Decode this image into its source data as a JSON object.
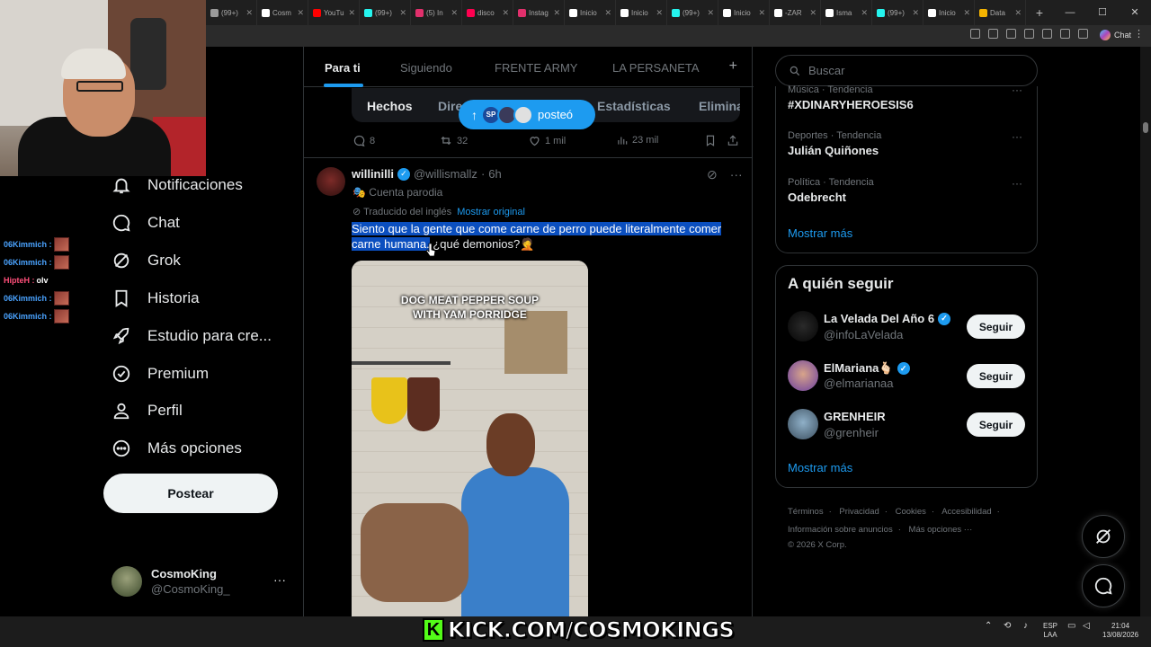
{
  "browser": {
    "tabs": [
      {
        "label": "(99+)",
        "color": "#9a9a9a"
      },
      {
        "label": "Cosm",
        "color": "#ffffff"
      },
      {
        "label": "YouTu",
        "color": "#ff0000"
      },
      {
        "label": "(99+)",
        "color": "#25f4ee"
      },
      {
        "label": "(5) In",
        "color": "#e1306c"
      },
      {
        "label": "disco",
        "color": "#ff0050"
      },
      {
        "label": "Instag",
        "color": "#e1306c"
      },
      {
        "label": "Inicio",
        "color": "#ffffff"
      },
      {
        "label": "Inicio",
        "color": "#ffffff"
      },
      {
        "label": "(99+)",
        "color": "#25f4ee"
      },
      {
        "label": "Inicio",
        "color": "#ffffff"
      },
      {
        "label": "-ZAR",
        "color": "#ffffff"
      },
      {
        "label": "Isma",
        "color": "#ffffff"
      },
      {
        "label": "(99+)",
        "color": "#25f4ee"
      },
      {
        "label": "Inicio",
        "color": "#ffffff"
      },
      {
        "label": "Data",
        "color": "#f4b400"
      }
    ],
    "chat_label": "Chat"
  },
  "chat_overlay": [
    {
      "user": "06Kimmich :",
      "msg": "",
      "emote": true,
      "red": false
    },
    {
      "user": "06Kimmich :",
      "msg": "",
      "emote": true,
      "red": false
    },
    {
      "user": "HipteH :",
      "msg": "olv",
      "emote": false,
      "red": true
    },
    {
      "user": "06Kimmich :",
      "msg": "",
      "emote": true,
      "red": false
    },
    {
      "user": "06Kimmich :",
      "msg": "",
      "emote": true,
      "red": false
    }
  ],
  "nav": {
    "notifications": "Notificaciones",
    "chat": "Chat",
    "grok": "Grok",
    "history": "Historia",
    "studio": "Estudio para cre...",
    "premium": "Premium",
    "profile": "Perfil",
    "more": "Más opciones",
    "post_button": "Postear"
  },
  "account": {
    "name": "CosmoKing",
    "handle": "@CosmoKing_"
  },
  "feed": {
    "tabs": [
      "Para ti",
      "Siguiendo",
      "FRENTE ARMY",
      "LA PERSANETA"
    ],
    "chips": [
      "Hechos",
      "Dire",
      "Estadísticas",
      "Elimina"
    ],
    "new_posts_label": "posteó",
    "new_posts_avatar": "SP",
    "prev_post_stats": {
      "replies": "8",
      "reposts": "32",
      "likes": "1 mil",
      "views": "23 mil"
    }
  },
  "post": {
    "name": "willinilli",
    "handle": "@willismallz",
    "time": "6h",
    "badge": "Cuenta parodia",
    "translated_label": "Traducido del inglés",
    "show_original": "Mostrar original",
    "text_selected": "Siento que la gente que come carne de perro puede literalmente comer carne humana.",
    "text_rest": " ¿qué demonios?🤦",
    "media_caption_1": "DOG MEAT PEPPER SOUP",
    "media_caption_2": "WITH YAM PORRIDGE"
  },
  "sidebar": {
    "search_placeholder": "Buscar",
    "trends": [
      {
        "meta": "Música · Tendencia",
        "name": "#XDINARYHEROESIS6"
      },
      {
        "meta": "Deportes · Tendencia",
        "name": "Julián Quiñones"
      },
      {
        "meta": "Política · Tendencia",
        "name": "Odebrecht"
      }
    ],
    "show_more": "Mostrar más",
    "follow_title": "A quién seguir",
    "follow": [
      {
        "name": "La Velada Del Año 6",
        "handle": "@infoLaVelada",
        "verified": true,
        "button": "Seguir"
      },
      {
        "name": "ElMariana🫰🏻",
        "handle": "@elmarianaa",
        "verified": true,
        "button": "Seguir"
      },
      {
        "name": "GRENHEIR",
        "handle": "@grenheir",
        "verified": false,
        "button": "Seguir"
      }
    ],
    "follow_show_more": "Mostrar más",
    "footer": [
      "Términos",
      "Privacidad",
      "Cookies",
      "Accesibilidad",
      "Información sobre anuncios",
      "Más opciones ···",
      "© 2026 X Corp."
    ]
  },
  "overlay": {
    "kick_text": "KICK.COM/COSMOKINGS"
  },
  "taskbar": {
    "lang_1": "ESP",
    "lang_2": "LAA",
    "time": "21:04",
    "date": "13/08/2026"
  },
  "colors": {
    "accent": "#1d9bf0",
    "kick": "#53fc18"
  }
}
